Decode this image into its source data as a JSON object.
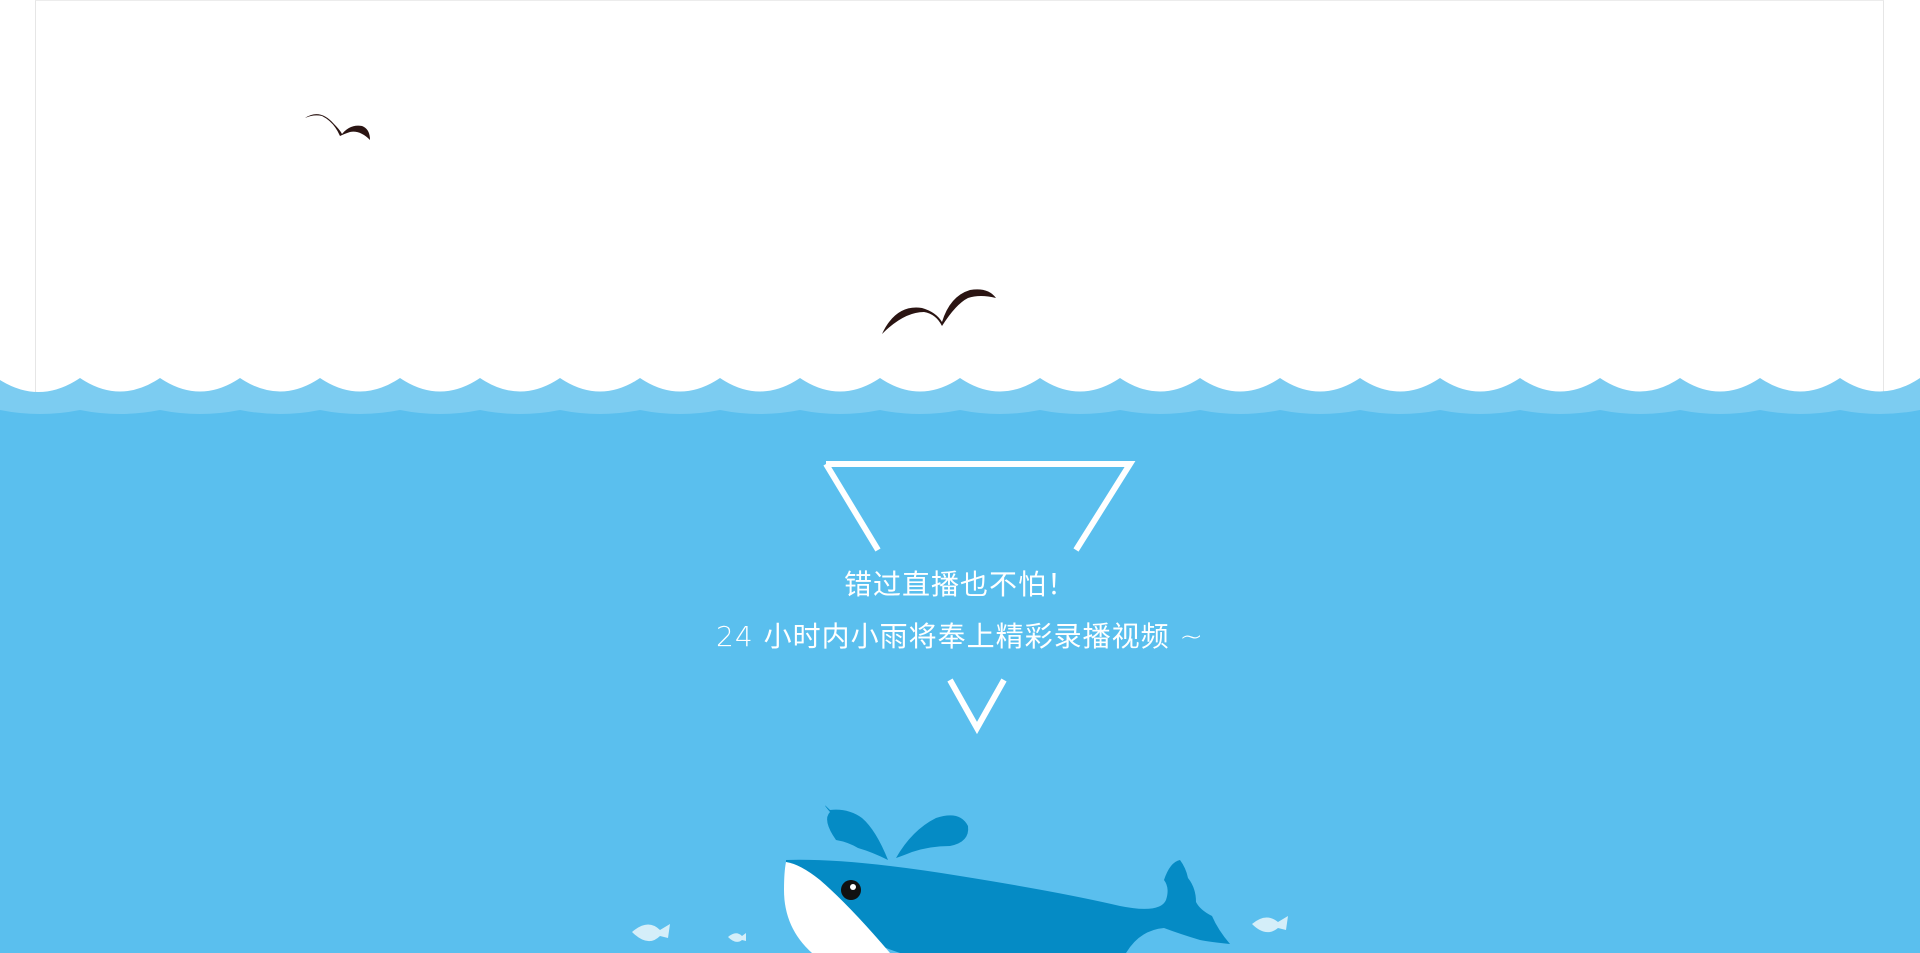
{
  "notice": {
    "headline": "错过直播也不怕！",
    "subline": "24 小时内小雨将奉上精彩录播视频 ~"
  },
  "colors": {
    "sky": "#ffffff",
    "sea": "#5abfee",
    "wave_light": "#7cccf1",
    "whale_dark": "#058bc5",
    "whale_belly": "#ffffff",
    "bird": "#2a1412",
    "fish": "#d4eef9",
    "text": "#ffffff"
  },
  "icons": {
    "bird_small": "seagull-icon",
    "bird_large": "seagull-icon",
    "triangle": "triangle-outline-icon",
    "chevron": "chevron-down-icon",
    "whale": "whale-icon",
    "fish": "fish-icon"
  }
}
